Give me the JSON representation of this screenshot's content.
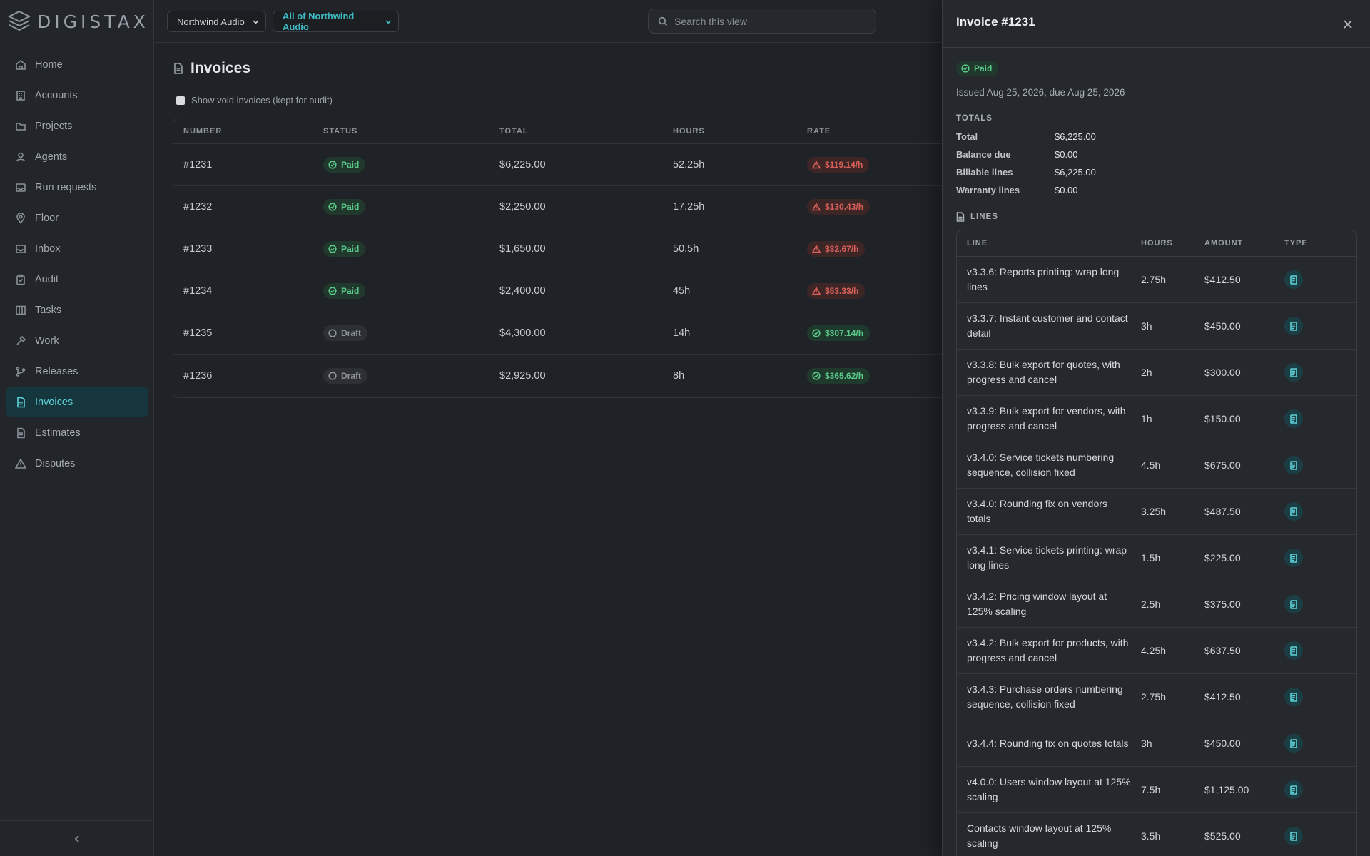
{
  "app": {
    "logo_text": "DIGISTAX"
  },
  "sidebar": {
    "items": [
      {
        "label": "Home",
        "icon": "home-icon"
      },
      {
        "label": "Accounts",
        "icon": "building-icon"
      },
      {
        "label": "Projects",
        "icon": "folder-icon"
      },
      {
        "label": "Agents",
        "icon": "user-icon"
      },
      {
        "label": "Run requests",
        "icon": "inbox-tray-icon"
      },
      {
        "label": "Floor",
        "icon": "map-pin-icon"
      },
      {
        "label": "Inbox",
        "icon": "inbox-icon"
      },
      {
        "label": "Audit",
        "icon": "clipboard-icon"
      },
      {
        "label": "Tasks",
        "icon": "columns-icon"
      },
      {
        "label": "Work",
        "icon": "hammer-icon"
      },
      {
        "label": "Releases",
        "icon": "git-branch-icon"
      },
      {
        "label": "Invoices",
        "icon": "file-icon",
        "active": true
      },
      {
        "label": "Estimates",
        "icon": "file-icon"
      },
      {
        "label": "Disputes",
        "icon": "warning-icon"
      }
    ],
    "collapse_icon": "chevron-left-icon"
  },
  "topbar": {
    "company_select": "Northwind Audio",
    "scope_select": "All of Northwind Audio",
    "search_placeholder": "Search this view"
  },
  "page": {
    "title": "Invoices",
    "void_toggle_label": "Show void invoices (kept for audit)",
    "columns": [
      "NUMBER",
      "STATUS",
      "TOTAL",
      "HOURS",
      "RATE"
    ],
    "rows": [
      {
        "number": "#1231",
        "status": "Paid",
        "total": "$6,225.00",
        "hours": "52.25h",
        "rate": "$119.14/h",
        "rate_flag": "bad"
      },
      {
        "number": "#1232",
        "status": "Paid",
        "total": "$2,250.00",
        "hours": "17.25h",
        "rate": "$130.43/h",
        "rate_flag": "bad"
      },
      {
        "number": "#1233",
        "status": "Paid",
        "total": "$1,650.00",
        "hours": "50.5h",
        "rate": "$32.67/h",
        "rate_flag": "bad"
      },
      {
        "number": "#1234",
        "status": "Paid",
        "total": "$2,400.00",
        "hours": "45h",
        "rate": "$53.33/h",
        "rate_flag": "bad"
      },
      {
        "number": "#1235",
        "status": "Draft",
        "total": "$4,300.00",
        "hours": "14h",
        "rate": "$307.14/h",
        "rate_flag": "good"
      },
      {
        "number": "#1236",
        "status": "Draft",
        "total": "$2,925.00",
        "hours": "8h",
        "rate": "$365.62/h",
        "rate_flag": "good"
      }
    ]
  },
  "drawer": {
    "title": "Invoice #1231",
    "status": "Paid",
    "issued_text": "Issued Aug 25, 2026, due Aug 25, 2026",
    "totals_label": "TOTALS",
    "totals": [
      {
        "key": "Total",
        "value": "$6,225.00"
      },
      {
        "key": "Balance due",
        "value": "$0.00"
      },
      {
        "key": "Billable lines",
        "value": "$6,225.00"
      },
      {
        "key": "Warranty lines",
        "value": "$0.00"
      }
    ],
    "lines_label": "LINES",
    "line_columns": [
      "LINE",
      "HOURS",
      "AMOUNT",
      "TYPE"
    ],
    "lines": [
      {
        "line": "v3.3.6: Reports printing: wrap long lines",
        "hours": "2.75h",
        "amount": "$412.50"
      },
      {
        "line": "v3.3.7: Instant customer and contact detail",
        "hours": "3h",
        "amount": "$450.00"
      },
      {
        "line": "v3.3.8: Bulk export for quotes, with progress and cancel",
        "hours": "2h",
        "amount": "$300.00"
      },
      {
        "line": "v3.3.9: Bulk export for vendors, with progress and cancel",
        "hours": "1h",
        "amount": "$150.00"
      },
      {
        "line": "v3.4.0: Service tickets numbering sequence, collision fixed",
        "hours": "4.5h",
        "amount": "$675.00"
      },
      {
        "line": "v3.4.0: Rounding fix on vendors totals",
        "hours": "3.25h",
        "amount": "$487.50"
      },
      {
        "line": "v3.4.1: Service tickets printing: wrap long lines",
        "hours": "1.5h",
        "amount": "$225.00"
      },
      {
        "line": "v3.4.2: Pricing window layout at 125% scaling",
        "hours": "2.5h",
        "amount": "$375.00"
      },
      {
        "line": "v3.4.2: Bulk export for products, with progress and cancel",
        "hours": "4.25h",
        "amount": "$637.50"
      },
      {
        "line": "v3.4.3: Purchase orders numbering sequence, collision fixed",
        "hours": "2.75h",
        "amount": "$412.50"
      },
      {
        "line": "v3.4.4: Rounding fix on quotes totals",
        "hours": "3h",
        "amount": "$450.00"
      },
      {
        "line": "v4.0.0: Users window layout at 125% scaling",
        "hours": "7.5h",
        "amount": "$1,125.00"
      },
      {
        "line": "Contacts window layout at 125% scaling",
        "hours": "3.5h",
        "amount": "$525.00"
      }
    ],
    "line_type_icon": "billable-document-icon"
  },
  "colors": {
    "accent": "#5fd3d9",
    "paid": "#5bc98a",
    "warn": "#d9605a",
    "draft": "#8f959b"
  }
}
